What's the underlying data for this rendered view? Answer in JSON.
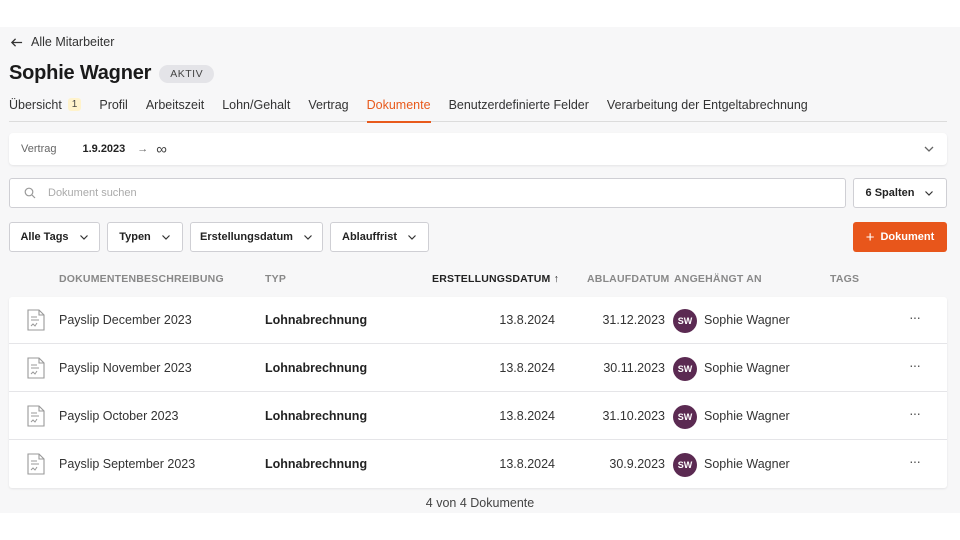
{
  "nav": {
    "back_label": "Alle Mitarbeiter"
  },
  "employee": {
    "name": "Sophie Wagner",
    "status": "AKTIV"
  },
  "tabs": [
    {
      "label": "Übersicht",
      "count": "1"
    },
    {
      "label": "Profil"
    },
    {
      "label": "Arbeitszeit"
    },
    {
      "label": "Lohn/Gehalt"
    },
    {
      "label": "Vertrag"
    },
    {
      "label": "Dokumente",
      "active": true
    },
    {
      "label": "Benutzerdefinierte Felder"
    },
    {
      "label": "Verarbeitung der Entgeltabrechnung"
    }
  ],
  "contract": {
    "label": "Vertrag",
    "start": "1.9.2023",
    "arrow": "→",
    "end": "∞"
  },
  "search": {
    "placeholder": "Dokument suchen",
    "value": ""
  },
  "columns_button": "6 Spalten",
  "filters": [
    "Alle Tags",
    "Typen",
    "Erstellungsdatum",
    "Ablauffrist"
  ],
  "add_button": "Dokument",
  "table": {
    "headers": {
      "description": "DOKUMENTENBESCHREIBUNG",
      "type": "TYP",
      "created": "ERSTELLUNGSDATUM",
      "sort_indicator": "↑",
      "expires": "ABLAUFDATUM",
      "attached": "ANGEHÄNGT AN",
      "tags": "TAGS"
    },
    "rows": [
      {
        "description": "Payslip December 2023",
        "type": "Lohnabrechnung",
        "created": "13.8.2024",
        "expires": "31.12.2023",
        "initials": "SW",
        "attached": "Sophie Wagner",
        "more": "···"
      },
      {
        "description": "Payslip November 2023",
        "type": "Lohnabrechnung",
        "created": "13.8.2024",
        "expires": "30.11.2023",
        "initials": "SW",
        "attached": "Sophie Wagner",
        "more": "···"
      },
      {
        "description": "Payslip October 2023",
        "type": "Lohnabrechnung",
        "created": "13.8.2024",
        "expires": "31.10.2023",
        "initials": "SW",
        "attached": "Sophie Wagner",
        "more": "···"
      },
      {
        "description": "Payslip September 2023",
        "type": "Lohnabrechnung",
        "created": "13.8.2024",
        "expires": "30.9.2023",
        "initials": "SW",
        "attached": "Sophie Wagner",
        "more": "···"
      }
    ]
  },
  "footer": "4 von 4 Dokumente",
  "colors": {
    "accent": "#e8561b",
    "avatar": "#5b2a52"
  }
}
